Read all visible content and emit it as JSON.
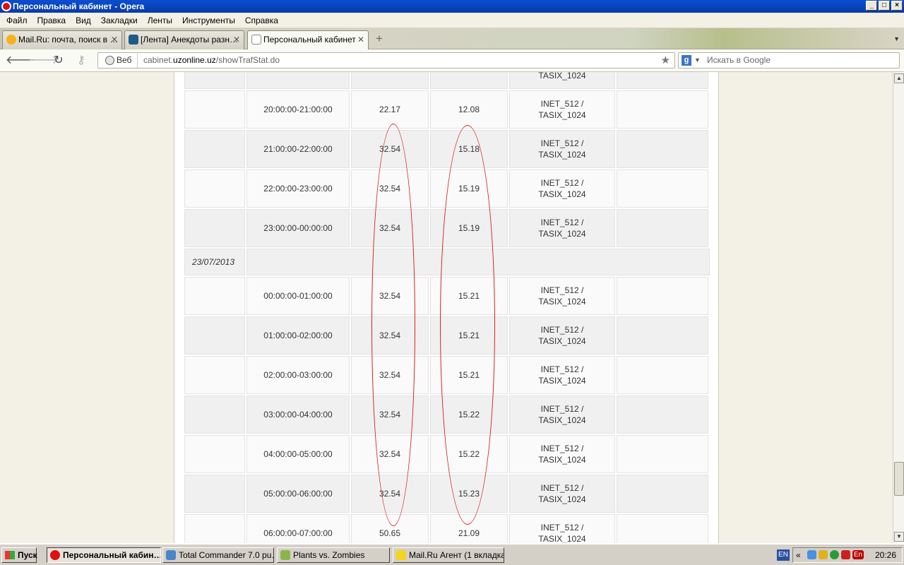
{
  "window": {
    "title": "Персональный кабинет - Opera"
  },
  "menu": [
    "Файл",
    "Правка",
    "Вид",
    "Закладки",
    "Ленты",
    "Инструменты",
    "Справка"
  ],
  "tabs": [
    {
      "label": "Mail.Ru: почта, поиск в …"
    },
    {
      "label": "[Лента] Анекдоты разн…"
    },
    {
      "label": "Персональный кабинет"
    }
  ],
  "address": {
    "web_label": "Веб",
    "url_prefix": "cabinet.",
    "url_domain": "uzonline.uz",
    "url_path": "/showTrafStat.do"
  },
  "search": {
    "placeholder": "Искать в Google"
  },
  "table": {
    "partial_row": {
      "tariff": "TASIX_1024"
    },
    "rows_before": [
      {
        "time": "20:00:00-21:00:00",
        "v1": "22.17",
        "v2": "12.08",
        "tariff1": "INET_512 /",
        "tariff2": "TASIX_1024"
      },
      {
        "time": "21:00:00-22:00:00",
        "v1": "32.54",
        "v2": "15.18",
        "tariff1": "INET_512 /",
        "tariff2": "TASIX_1024"
      },
      {
        "time": "22:00:00-23:00:00",
        "v1": "32.54",
        "v2": "15.19",
        "tariff1": "INET_512 /",
        "tariff2": "TASIX_1024"
      },
      {
        "time": "23:00:00-00:00:00",
        "v1": "32.54",
        "v2": "15.19",
        "tariff1": "INET_512 /",
        "tariff2": "TASIX_1024"
      }
    ],
    "date": "23/07/2013",
    "rows_after": [
      {
        "time": "00:00:00-01:00:00",
        "v1": "32.54",
        "v2": "15.21",
        "tariff1": "INET_512 /",
        "tariff2": "TASIX_1024"
      },
      {
        "time": "01:00:00-02:00:00",
        "v1": "32.54",
        "v2": "15.21",
        "tariff1": "INET_512 /",
        "tariff2": "TASIX_1024"
      },
      {
        "time": "02:00:00-03:00:00",
        "v1": "32.54",
        "v2": "15.21",
        "tariff1": "INET_512 /",
        "tariff2": "TASIX_1024"
      },
      {
        "time": "03:00:00-04:00:00",
        "v1": "32.54",
        "v2": "15.22",
        "tariff1": "INET_512 /",
        "tariff2": "TASIX_1024"
      },
      {
        "time": "04:00:00-05:00:00",
        "v1": "32.54",
        "v2": "15.22",
        "tariff1": "INET_512 /",
        "tariff2": "TASIX_1024"
      },
      {
        "time": "05:00:00-06:00:00",
        "v1": "32.54",
        "v2": "15.23",
        "tariff1": "INET_512 /",
        "tariff2": "TASIX_1024"
      },
      {
        "time": "06:00:00-07:00:00",
        "v1": "50.65",
        "v2": "21.09",
        "tariff1": "INET_512 /",
        "tariff2": "TASIX_1024"
      }
    ]
  },
  "taskbar": {
    "start": "Пуск",
    "tasks": [
      "Персональный кабин…",
      "Total Commander 7.0 pu…",
      "Plants vs. Zombies",
      "Mail.Ru Агент (1 вкладка)"
    ],
    "lang": "EN",
    "tray_lang": "En",
    "clock": "20:26"
  },
  "colors": {
    "highlight_ellipse": "#d92020",
    "titlebar": "#0a4fd0"
  }
}
